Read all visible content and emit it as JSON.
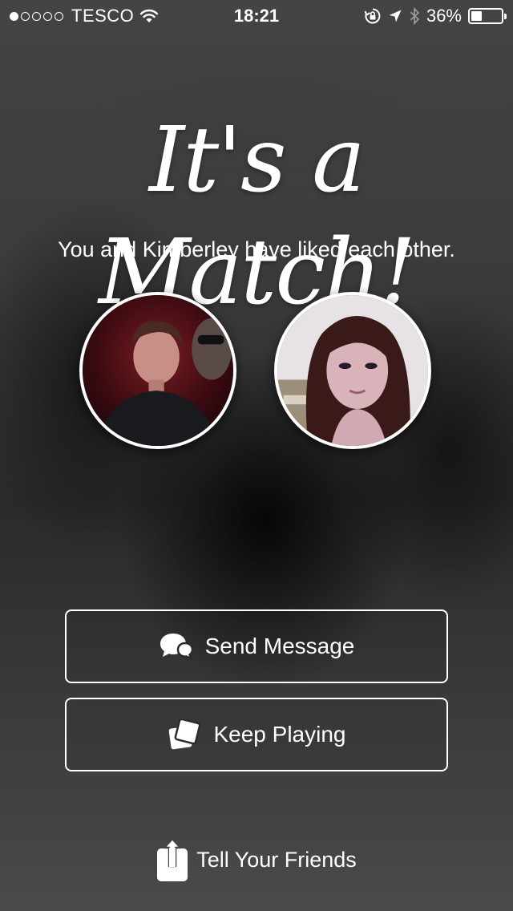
{
  "status_bar": {
    "signal_strength": 1,
    "signal_max": 5,
    "carrier": "TESCO",
    "time": "18:21",
    "battery_percent_label": "36%",
    "battery_level": 0.36,
    "icons": [
      "wifi-icon",
      "rotation-lock-icon",
      "location-arrow-icon",
      "bluetooth-icon",
      "battery-icon"
    ]
  },
  "match": {
    "title": "It's a Match!",
    "subtitle": "You and Kimberley have liked each other."
  },
  "avatars": {
    "me": {
      "icon": "user-photo"
    },
    "match": {
      "icon": "match-photo"
    }
  },
  "actions": {
    "send_message": {
      "label": "Send Message",
      "icon": "chat-bubbles-icon"
    },
    "keep_playing": {
      "label": "Keep Playing",
      "icon": "cards-icon"
    },
    "tell_friends": {
      "label": "Tell Your Friends",
      "icon": "share-icon"
    }
  },
  "colors": {
    "text": "#ffffff",
    "border": "#ffffff",
    "background": "#3a3a3a"
  }
}
